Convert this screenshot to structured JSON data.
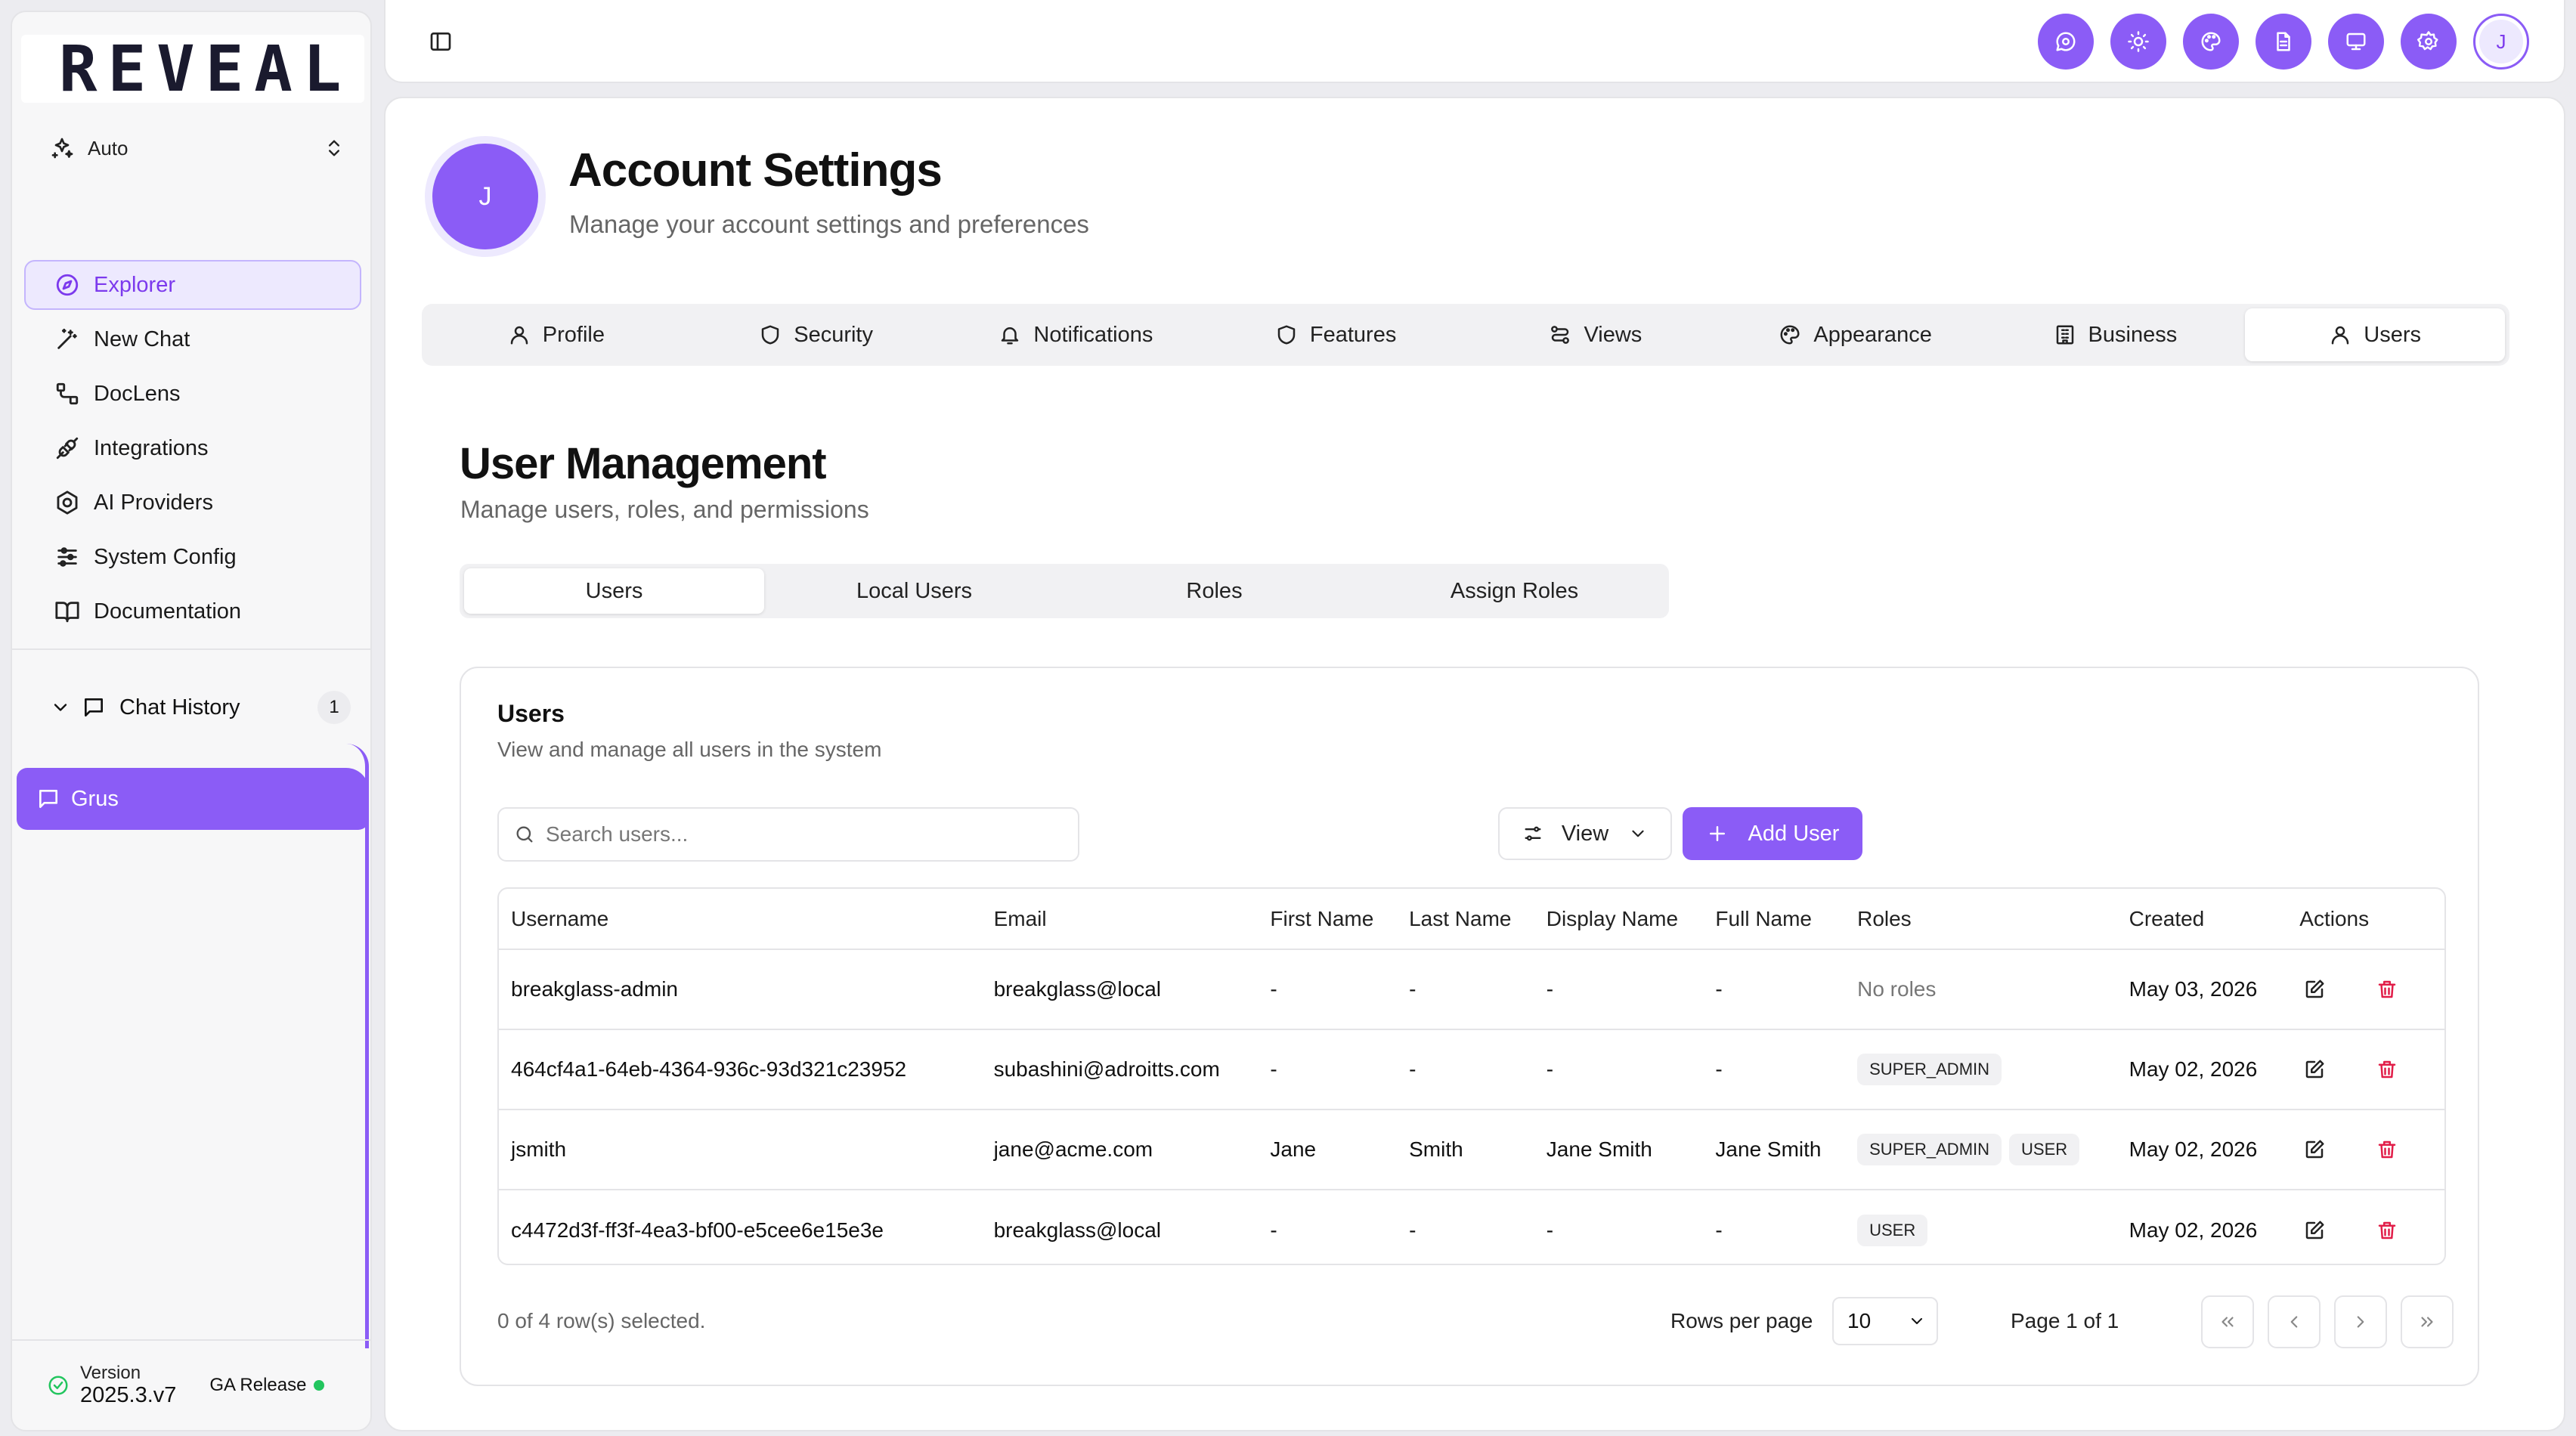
{
  "sidebar": {
    "logo": "REVEAL",
    "mode": "Auto",
    "nav": [
      {
        "label": "Explorer",
        "icon": "compass-icon",
        "active": true
      },
      {
        "label": "New Chat",
        "icon": "wand-icon"
      },
      {
        "label": "DocLens",
        "icon": "workflow-icon"
      },
      {
        "label": "Integrations",
        "icon": "plug-icon"
      },
      {
        "label": "AI Providers",
        "icon": "hexagon-icon"
      },
      {
        "label": "System Config",
        "icon": "sliders-icon"
      },
      {
        "label": "Documentation",
        "icon": "book-icon"
      }
    ],
    "chat_history": {
      "label": "Chat History",
      "count": "1",
      "items": [
        "Grus"
      ]
    },
    "version": {
      "label": "Version",
      "number": "2025.3.v7",
      "release": "GA Release"
    }
  },
  "topbar": {
    "icons": [
      "chat-icon",
      "sun-icon",
      "palette-icon",
      "document-icon",
      "monitor-icon",
      "gear-icon"
    ],
    "avatar_initial": "J"
  },
  "header": {
    "avatar_initial": "J",
    "title": "Account Settings",
    "subtitle": "Manage your account settings and preferences"
  },
  "tabs": [
    {
      "label": "Profile",
      "icon": "user-icon"
    },
    {
      "label": "Security",
      "icon": "shield-icon"
    },
    {
      "label": "Notifications",
      "icon": "bell-icon"
    },
    {
      "label": "Features",
      "icon": "shield-icon"
    },
    {
      "label": "Views",
      "icon": "route-icon"
    },
    {
      "label": "Appearance",
      "icon": "palette-icon"
    },
    {
      "label": "Business",
      "icon": "building-icon"
    },
    {
      "label": "Users",
      "icon": "user-icon",
      "active": true
    }
  ],
  "section": {
    "title": "User Management",
    "subtitle": "Manage users, roles, and permissions",
    "subtabs": [
      "Users",
      "Local Users",
      "Roles",
      "Assign Roles"
    ],
    "active_subtab": "Users"
  },
  "card": {
    "title": "Users",
    "subtitle": "View and manage all users in the system",
    "search_placeholder": "Search users...",
    "view_label": "View",
    "add_label": "Add User",
    "columns": [
      "Username",
      "Email",
      "First Name",
      "Last Name",
      "Display Name",
      "Full Name",
      "Roles",
      "Created",
      "Actions"
    ],
    "rows": [
      {
        "username": "breakglass-admin",
        "email": "breakglass@local",
        "first": "-",
        "last": "-",
        "display": "-",
        "full": "-",
        "roles": [],
        "no_roles": "No roles",
        "created": "May 03, 2026"
      },
      {
        "username": "464cf4a1-64eb-4364-936c-93d321c23952",
        "email": "subashini@adroitts.com",
        "first": "-",
        "last": "-",
        "display": "-",
        "full": "-",
        "roles": [
          "SUPER_ADMIN"
        ],
        "created": "May 02, 2026"
      },
      {
        "username": "jsmith",
        "email": "jane@acme.com",
        "first": "Jane",
        "last": "Smith",
        "display": "Jane Smith",
        "full": "Jane Smith",
        "roles": [
          "SUPER_ADMIN",
          "USER"
        ],
        "created": "May 02, 2026"
      },
      {
        "username": "c4472d3f-ff3f-4ea3-bf00-e5cee6e15e3e",
        "email": "breakglass@local",
        "first": "-",
        "last": "-",
        "display": "-",
        "full": "-",
        "roles": [
          "USER"
        ],
        "created": "May 02, 2026"
      }
    ],
    "selection": "0 of 4 row(s) selected.",
    "rows_per_page_label": "Rows per page",
    "rows_per_page": "10",
    "page_info": "Page 1 of 1"
  },
  "colors": {
    "accent": "#8b5cf6",
    "danger": "#e11d48",
    "success": "#22c55e"
  }
}
